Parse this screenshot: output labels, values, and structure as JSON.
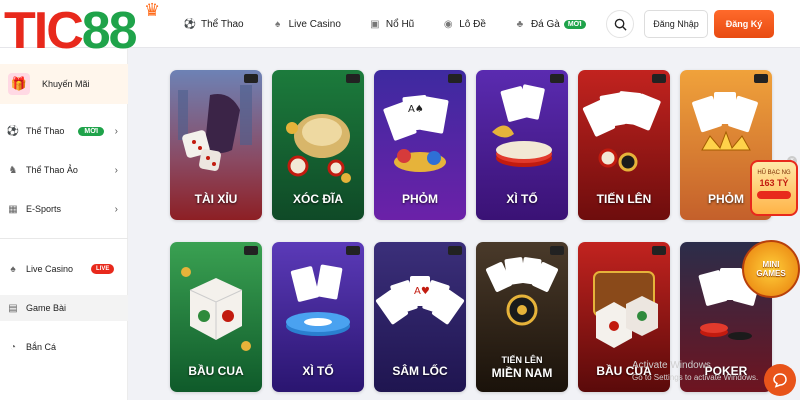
{
  "brand": {
    "logo_tic": "TIC",
    "logo_num": "88"
  },
  "header": {
    "nav": [
      {
        "label": "Thể Thao",
        "icon": "soccer-ball-icon"
      },
      {
        "label": "Live Casino",
        "icon": "spade-icon"
      },
      {
        "label": "Nổ Hũ",
        "icon": "slot-machine-icon"
      },
      {
        "label": "Lô Đề",
        "icon": "lottery-icon"
      },
      {
        "label": "Đá Gà",
        "icon": "rooster-icon",
        "badge": "MỚI"
      }
    ],
    "login_label": "Đăng Nhập",
    "register_label": "Đăng Ký"
  },
  "sidebar": {
    "promo_label": "Khuyến Mãi",
    "items": [
      {
        "label": "Thể Thao",
        "badge": "MỚI",
        "chevron": true
      },
      {
        "label": "Thể Thao Ảo",
        "chevron": true
      },
      {
        "label": "E-Sports",
        "chevron": true
      },
      {
        "label": "Live Casino",
        "badge": "LIVE"
      },
      {
        "label": "Game Bài",
        "active": true
      },
      {
        "label": "Bắn Cá"
      }
    ]
  },
  "games": [
    {
      "title": "TÀI XỈU"
    },
    {
      "title": "XÓC ĐĨA"
    },
    {
      "title": "PHỎM"
    },
    {
      "title": "XÌ TỐ"
    },
    {
      "title": "TIẾN LÊN"
    },
    {
      "title": "PHỎM"
    },
    {
      "title": "BẦU CUA"
    },
    {
      "title": "XÌ TỐ"
    },
    {
      "title": "SÂM LỐC"
    },
    {
      "title_line1": "TIẾN LÊN",
      "title_line2": "MIỀN NAM"
    },
    {
      "title": "BẦU CUA"
    },
    {
      "title": "POKER"
    }
  ],
  "jackpot": {
    "label": "HŨ BẠC NG",
    "amount": "163 TỶ"
  },
  "minigame": {
    "label_line1": "MINI",
    "label_line2": "GAMES"
  },
  "watermark": {
    "line1": "Activate Windows",
    "line2": "Go to Settings to activate Windows."
  },
  "colors": {
    "accent": "#e8541a",
    "brand_red": "#e8291c",
    "brand_green": "#1fa34a"
  }
}
